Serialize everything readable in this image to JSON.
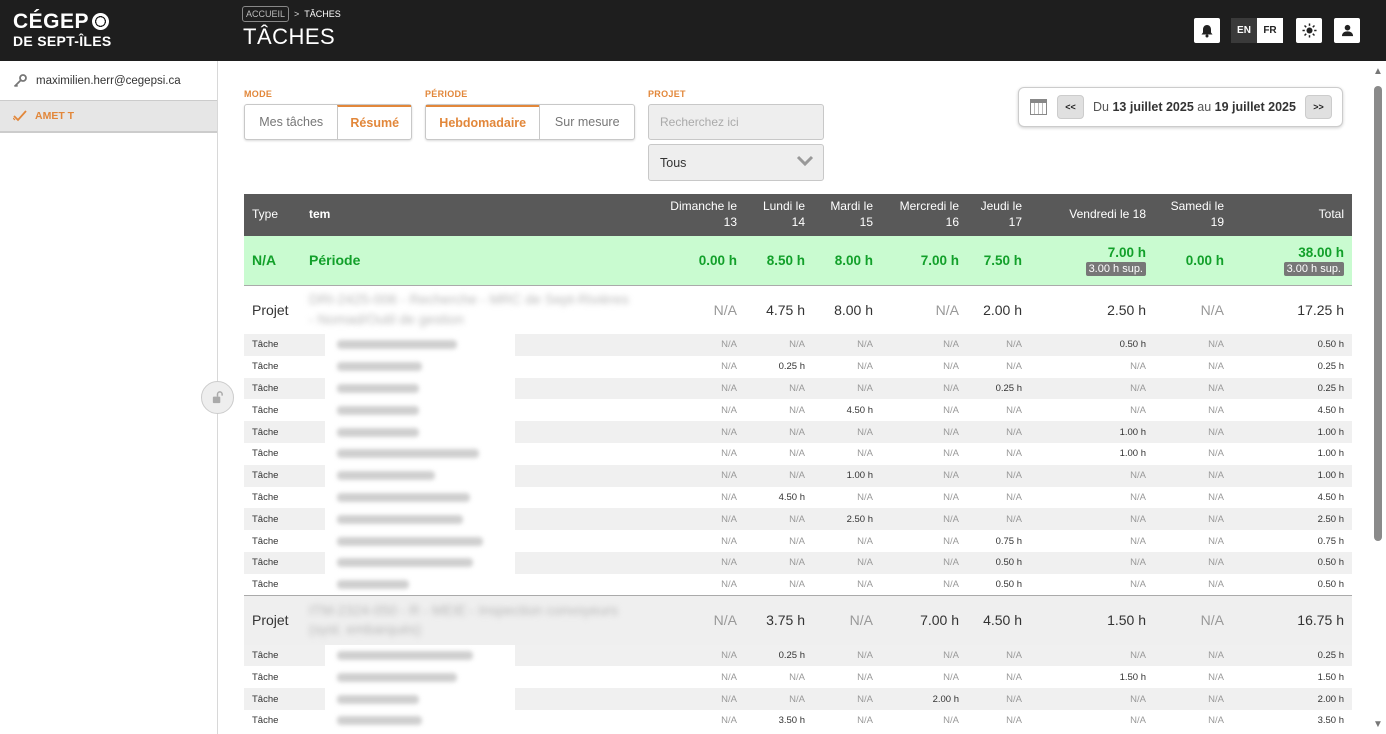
{
  "header": {
    "logo_line1": "CÉGEP",
    "logo_line2": "DE SEPT-ÎLES",
    "breadcrumb_home": "ACCUEIL",
    "breadcrumb_sep": ">",
    "breadcrumb_current": "TÂCHES",
    "title": "TÂCHES",
    "lang_en": "EN",
    "lang_fr": "FR"
  },
  "sidebar": {
    "user_email": "maximilien.herr@cegepsi.ca",
    "items": [
      {
        "label": "AMET T"
      }
    ]
  },
  "filters": {
    "mode_label": "MODE",
    "mode_options": [
      "Mes tâches",
      "Résumé"
    ],
    "mode_selected": "Résumé",
    "period_label": "PÉRIODE",
    "period_options": [
      "Hebdomadaire",
      "Sur mesure"
    ],
    "period_selected": "Hebdomadaire",
    "project_label": "PROJET",
    "search_placeholder": "Recherchez ici",
    "select_value": "Tous"
  },
  "date_nav": {
    "prev": "<<",
    "next": ">>",
    "prefix": "Du",
    "start": "13 juillet 2025",
    "middle": "au",
    "end": "19 juillet 2025"
  },
  "table": {
    "headers": {
      "type": "Type",
      "item": "tem",
      "d1a": "Dimanche le",
      "d1b": "13",
      "d2a": "Lundi le",
      "d2b": "14",
      "d3a": "Mardi le",
      "d3b": "15",
      "d4a": "Mercredi le",
      "d4b": "16",
      "d5a": "Jeudi le",
      "d5b": "17",
      "d6": "Vendredi le 18",
      "d7a": "Samedi le",
      "d7b": "19",
      "total": "Total"
    },
    "period_row": {
      "type": "N/A",
      "name": "Période",
      "values": [
        "0.00 h",
        "8.50 h",
        "8.00 h",
        "7.00 h",
        "7.50 h",
        "7.00 h",
        "0.00 h",
        "38.00 h"
      ],
      "friday_sup": "3.00 h sup.",
      "total_sup": "3.00 h sup."
    },
    "projects": [
      {
        "type": "Projet",
        "name": "DRI-2425-006 - Recherche - MRC de Sept-Rivières - Nomad/Outil de gestion",
        "values": [
          "N/A",
          "4.75 h",
          "8.00 h",
          "N/A",
          "2.00 h",
          "2.50 h",
          "N/A",
          "17.25 h"
        ],
        "tasks": [
          {
            "type": "Tâche",
            "name": "aliqua adipiscing consect",
            "values": [
              "N/A",
              "N/A",
              "N/A",
              "N/A",
              "N/A",
              "0.50 h",
              "N/A",
              "0.50 h"
            ]
          },
          {
            "type": "Tâche",
            "name": "lorem consecte",
            "values": [
              "N/A",
              "0.25 h",
              "N/A",
              "N/A",
              "N/A",
              "N/A",
              "N/A",
              "0.25 h"
            ]
          },
          {
            "type": "Tâche",
            "name": "sed ut aliqua",
            "values": [
              "N/A",
              "N/A",
              "N/A",
              "N/A",
              "0.25 h",
              "N/A",
              "N/A",
              "0.25 h"
            ]
          },
          {
            "type": "Tâche",
            "name": "labore ut mag",
            "values": [
              "N/A",
              "N/A",
              "4.50 h",
              "N/A",
              "N/A",
              "N/A",
              "N/A",
              "4.50 h"
            ]
          },
          {
            "type": "Tâche",
            "name": "sit amet do i",
            "values": [
              "N/A",
              "N/A",
              "N/A",
              "N/A",
              "N/A",
              "1.00 h",
              "N/A",
              "1.00 h"
            ]
          },
          {
            "type": "Tâche",
            "name": "aliqua adipiscing dolor elit tem",
            "values": [
              "N/A",
              "N/A",
              "N/A",
              "N/A",
              "N/A",
              "1.00 h",
              "N/A",
              "1.00 h"
            ]
          },
          {
            "type": "Tâche",
            "name": "dolore amet eiusmo",
            "values": [
              "N/A",
              "N/A",
              "1.00 h",
              "N/A",
              "N/A",
              "N/A",
              "N/A",
              "1.00 h"
            ]
          },
          {
            "type": "Tâche",
            "name": "ipsum aliqua adipiscing dolor",
            "values": [
              "N/A",
              "4.50 h",
              "N/A",
              "N/A",
              "N/A",
              "N/A",
              "N/A",
              "4.50 h"
            ]
          },
          {
            "type": "Tâche",
            "name": "adipiscing sit amet aliquam",
            "values": [
              "N/A",
              "N/A",
              "2.50 h",
              "N/A",
              "N/A",
              "N/A",
              "N/A",
              "2.50 h"
            ]
          },
          {
            "type": "Tâche",
            "name": "amet dolore eiusmod tempor aliqua",
            "values": [
              "N/A",
              "N/A",
              "N/A",
              "N/A",
              "0.75 h",
              "N/A",
              "N/A",
              "0.75 h"
            ]
          },
          {
            "type": "Tâche",
            "name": "dolor sit amet adipiscing elit",
            "values": [
              "N/A",
              "N/A",
              "N/A",
              "N/A",
              "0.50 h",
              "N/A",
              "N/A",
              "0.50 h"
            ]
          },
          {
            "type": "Tâche",
            "name": "adipiscing",
            "values": [
              "N/A",
              "N/A",
              "N/A",
              "N/A",
              "0.50 h",
              "N/A",
              "N/A",
              "0.50 h"
            ]
          }
        ]
      },
      {
        "type": "Projet",
        "name": "ITM-2324-050 - R - MEIE - Inspection convoyeurs (syst. embarqués)",
        "values": [
          "N/A",
          "3.75 h",
          "N/A",
          "7.00 h",
          "4.50 h",
          "1.50 h",
          "N/A",
          "16.75 h"
        ],
        "tasks": [
          {
            "type": "Tâche",
            "name": "sed lorem labore incididunt ex",
            "values": [
              "N/A",
              "0.25 h",
              "N/A",
              "N/A",
              "N/A",
              "N/A",
              "N/A",
              "0.25 h"
            ]
          },
          {
            "type": "Tâche",
            "name": "do dolor sit amet ipsum a",
            "values": [
              "N/A",
              "N/A",
              "N/A",
              "N/A",
              "N/A",
              "1.50 h",
              "N/A",
              "1.50 h"
            ]
          },
          {
            "type": "Tâche",
            "name": "labore aliqua",
            "values": [
              "N/A",
              "N/A",
              "N/A",
              "2.00 h",
              "N/A",
              "N/A",
              "N/A",
              "2.00 h"
            ]
          },
          {
            "type": "Tâche",
            "name": "elit do do sed",
            "values": [
              "N/A",
              "3.50 h",
              "N/A",
              "N/A",
              "N/A",
              "N/A",
              "N/A",
              "3.50 h"
            ]
          }
        ]
      }
    ]
  },
  "colors": {
    "accent": "#e2873a",
    "header_bg": "#1e1e1e",
    "period_bg": "#c9fbd0",
    "period_text": "#12a02a",
    "table_header_bg": "#595959"
  },
  "icons": {
    "bell": "bell-icon",
    "theme": "sun-icon",
    "user": "user-icon",
    "key": "key-icon",
    "check": "check-icon",
    "lock": "unlock-icon",
    "calendar": "calendar-icon"
  }
}
